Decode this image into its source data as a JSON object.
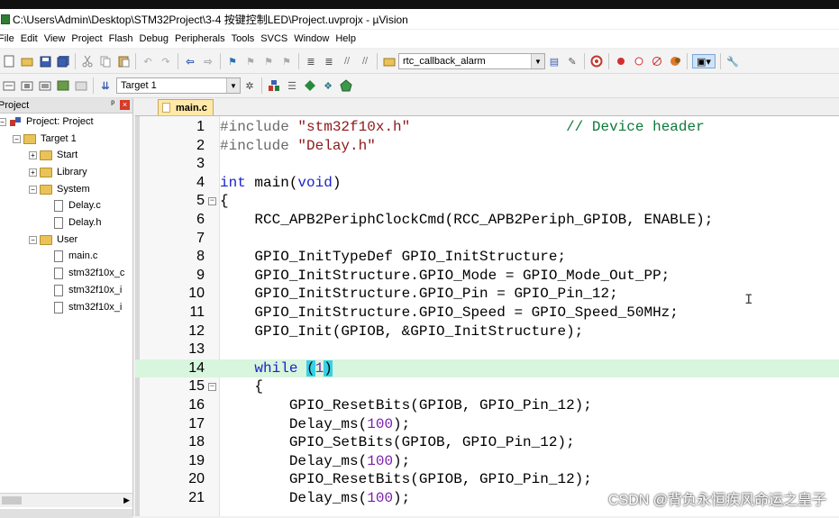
{
  "window": {
    "title": "C:\\Users\\Admin\\Desktop\\STM32Project\\3-4 按键控制LED\\Project.uvprojx - µVision"
  },
  "menu": [
    "File",
    "Edit",
    "View",
    "Project",
    "Flash",
    "Debug",
    "Peripherals",
    "Tools",
    "SVCS",
    "Window",
    "Help"
  ],
  "toolbar": {
    "function_combo": "rtc_callback_alarm",
    "target_combo": "Target 1"
  },
  "project_panel": {
    "title": "Project",
    "pin_glyph": "ᵖ",
    "close_glyph": "×",
    "tree": [
      {
        "label": "Project: Project",
        "level": 0,
        "kind": "project",
        "expander": "−"
      },
      {
        "label": "Target 1",
        "level": 1,
        "kind": "target",
        "expander": "−"
      },
      {
        "label": "Start",
        "level": 2,
        "kind": "folder",
        "expander": "+"
      },
      {
        "label": "Library",
        "level": 2,
        "kind": "folder",
        "expander": "+"
      },
      {
        "label": "System",
        "level": 2,
        "kind": "folder",
        "expander": "−"
      },
      {
        "label": "Delay.c",
        "level": 3,
        "kind": "file",
        "expander": "+"
      },
      {
        "label": "Delay.h",
        "level": 3,
        "kind": "file",
        "expander": ""
      },
      {
        "label": "User",
        "level": 2,
        "kind": "folder",
        "expander": "−"
      },
      {
        "label": "main.c",
        "level": 3,
        "kind": "file",
        "expander": "+"
      },
      {
        "label": "stm32f10x_c",
        "level": 3,
        "kind": "file",
        "expander": ""
      },
      {
        "label": "stm32f10x_i",
        "level": 3,
        "kind": "file",
        "expander": ""
      },
      {
        "label": "stm32f10x_i",
        "level": 3,
        "kind": "file",
        "expander": ""
      }
    ]
  },
  "editor": {
    "active_tab": "main.c",
    "current_line": 14,
    "lines": [
      {
        "n": "1",
        "text": "#include \"stm32f10x.h\"                  // Device header"
      },
      {
        "n": "2",
        "text": "#include \"Delay.h\""
      },
      {
        "n": "3",
        "text": ""
      },
      {
        "n": "4",
        "text": "int main(void)"
      },
      {
        "n": "5",
        "text": "{",
        "fold": "−"
      },
      {
        "n": "6",
        "text": "    RCC_APB2PeriphClockCmd(RCC_APB2Periph_GPIOB, ENABLE);"
      },
      {
        "n": "7",
        "text": ""
      },
      {
        "n": "8",
        "text": "    GPIO_InitTypeDef GPIO_InitStructure;"
      },
      {
        "n": "9",
        "text": "    GPIO_InitStructure.GPIO_Mode = GPIO_Mode_Out_PP;"
      },
      {
        "n": "10",
        "text": "    GPIO_InitStructure.GPIO_Pin = GPIO_Pin_12;"
      },
      {
        "n": "11",
        "text": "    GPIO_InitStructure.GPIO_Speed = GPIO_Speed_50MHz;"
      },
      {
        "n": "12",
        "text": "    GPIO_Init(GPIOB, &GPIO_InitStructure);"
      },
      {
        "n": "13",
        "text": ""
      },
      {
        "n": "14",
        "text": "    while (1)"
      },
      {
        "n": "15",
        "text": "    {",
        "fold": "−"
      },
      {
        "n": "16",
        "text": "        GPIO_ResetBits(GPIOB, GPIO_Pin_12);"
      },
      {
        "n": "17",
        "text": "        Delay_ms(100);"
      },
      {
        "n": "18",
        "text": "        GPIO_SetBits(GPIOB, GPIO_Pin_12);"
      },
      {
        "n": "19",
        "text": "        Delay_ms(100);"
      },
      {
        "n": "20",
        "text": "        GPIO_ResetBits(GPIOB, GPIO_Pin_12);"
      },
      {
        "n": "21",
        "text": "        Delay_ms(100);"
      }
    ]
  },
  "watermark": "CSDN @背负永恒疾风命运之皇子",
  "colors": {
    "keyword": "#1a23c9",
    "preprocessor": "#6a6a6a",
    "string": "#8b1a1a",
    "comment": "#0c7a3b",
    "number": "#7a1fae",
    "current_line": "#d8f5dd",
    "bracket_match": "#35d2e6"
  }
}
